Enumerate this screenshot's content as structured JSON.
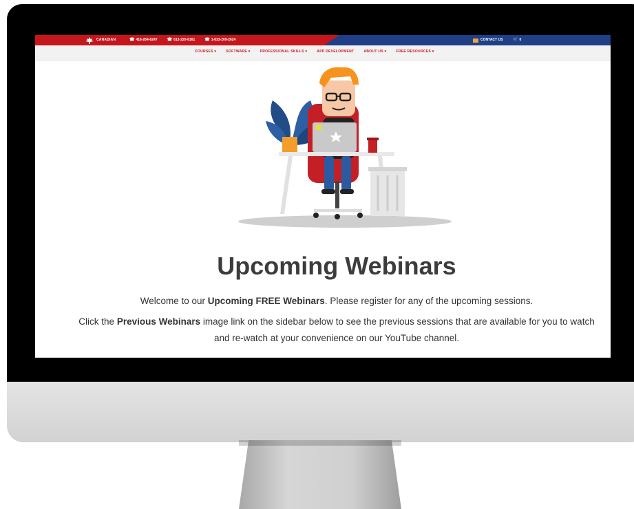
{
  "topbar": {
    "logo_text": "CANADIAN",
    "phones": [
      "416-264-6247",
      "613-220-6161",
      "1-833-209-2624"
    ],
    "contact_label": "CONTACT US",
    "cart_count": "0",
    "colors": {
      "red": "#c4161c",
      "blue": "#1f3f87",
      "accent": "#f2a33a"
    }
  },
  "nav": {
    "items": [
      "COURSES",
      "SOFTWARE",
      "PROFESSIONAL SKILLS",
      "APP DEVELOPMENT",
      "ABOUT US",
      "FREE RESOURCES"
    ],
    "dropdown_flags": [
      true,
      true,
      true,
      false,
      true,
      true
    ]
  },
  "page": {
    "title": "Upcoming Webinars",
    "intro_start": "Welcome to our ",
    "intro_bold": "Upcoming FREE Webinars",
    "intro_end": ". Please register for any of the upcoming sessions.",
    "prev_start": "Click the ",
    "prev_bold": "Previous Webinars",
    "prev_end": " image link on the sidebar below to see the previous sessions that are available for you to watch and re-watch at your convenience on our YouTube channel."
  }
}
